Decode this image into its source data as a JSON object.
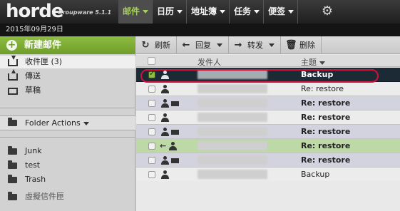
{
  "app": {
    "logo": "horde",
    "logo_sub": "Groupware 5.1.1"
  },
  "nav": {
    "items": [
      {
        "label": "邮件",
        "active": true
      },
      {
        "label": "日历",
        "active": false
      },
      {
        "label": "地址簿",
        "active": false
      },
      {
        "label": "任务",
        "active": false
      },
      {
        "label": "便签",
        "active": false
      }
    ],
    "settings_icon": "gear-icon"
  },
  "date": "2015年09月29日",
  "sidebar": {
    "new_mail_label": "新建邮件",
    "mailboxes": [
      {
        "label": "收件匣 (3)",
        "icon": "inbox-icon",
        "selected": true
      },
      {
        "label": "傳送",
        "icon": "sent-icon",
        "selected": false
      },
      {
        "label": "草稿",
        "icon": "drafts-icon",
        "selected": false
      }
    ],
    "folder_actions_label": "Folder Actions",
    "folders": [
      {
        "label": "Junk",
        "icon": "folder-icon"
      },
      {
        "label": "test",
        "icon": "folder-icon"
      },
      {
        "label": "Trash",
        "icon": "folder-icon"
      },
      {
        "label": "虛擬信件匣",
        "icon": "virtual-folder-icon"
      }
    ]
  },
  "toolbar": {
    "refresh_label": "刷新",
    "reply_label": "回复",
    "forward_label": "转发",
    "delete_label": "删除"
  },
  "list": {
    "header_sender": "发件人",
    "header_subject": "主题",
    "rows": [
      {
        "subject": "Backup",
        "selected": true,
        "unread": true,
        "attachment": false,
        "replied": false
      },
      {
        "subject": "Re: restore",
        "selected": false,
        "unread": true,
        "attachment": false,
        "replied": false
      },
      {
        "subject": "Re: restore",
        "selected": false,
        "unread": true,
        "attachment": true,
        "replied": false
      },
      {
        "subject": "Re: restore",
        "selected": false,
        "unread": true,
        "attachment": false,
        "replied": false
      },
      {
        "subject": "Re: restore",
        "selected": false,
        "unread": true,
        "attachment": true,
        "replied": false
      },
      {
        "subject": "Re: restore",
        "selected": false,
        "unread": true,
        "attachment": false,
        "replied": true
      },
      {
        "subject": "Re: restore",
        "selected": false,
        "unread": true,
        "attachment": true,
        "replied": false
      },
      {
        "subject": "Backup",
        "selected": false,
        "unread": false,
        "attachment": false,
        "replied": false
      }
    ]
  },
  "colors": {
    "accent_green": "#8ebd42",
    "highlight_ring": "#d3103a",
    "selected_row": "#1c2a35"
  }
}
